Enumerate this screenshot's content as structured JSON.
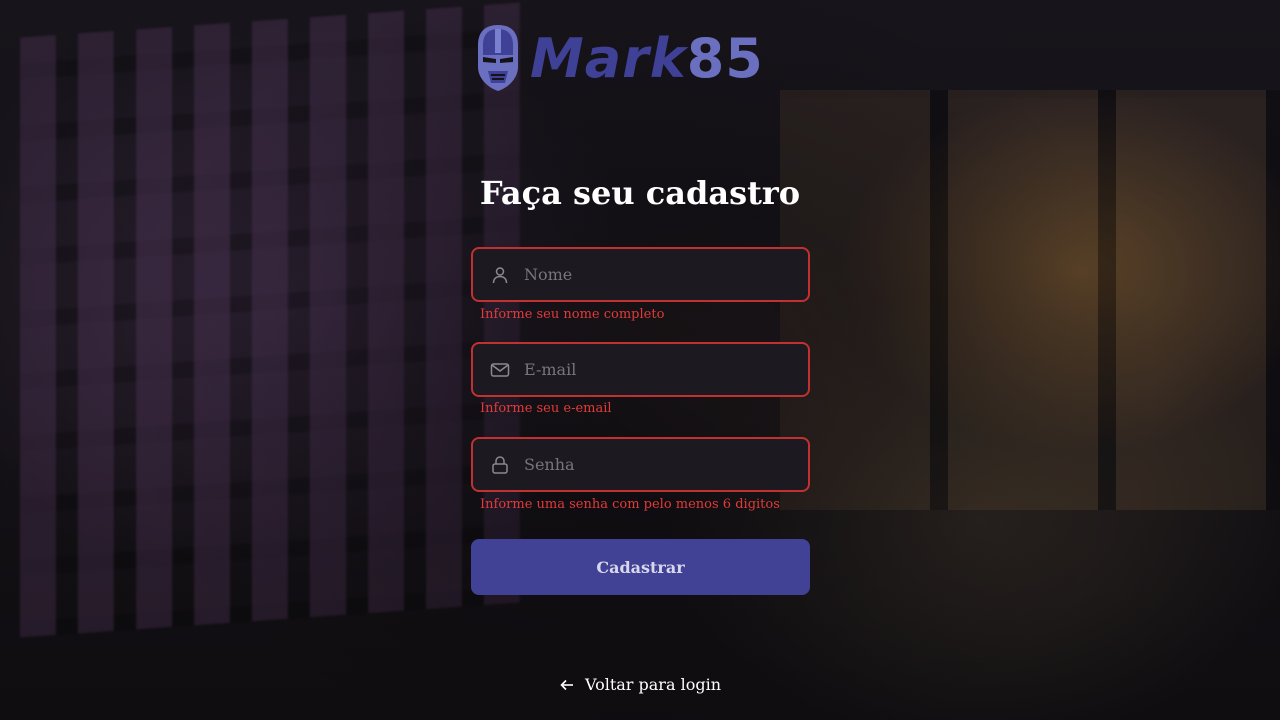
{
  "logo": {
    "part1": "Mark",
    "part2": "85",
    "icon": "iron-mask-icon"
  },
  "title": "Faça seu cadastro",
  "fields": {
    "name": {
      "placeholder": "Nome",
      "value": "",
      "error": "Informe seu nome completo",
      "icon": "user-icon"
    },
    "email": {
      "placeholder": "E-mail",
      "value": "",
      "error": "Informe seu e-email",
      "icon": "mail-icon"
    },
    "password": {
      "placeholder": "Senha",
      "value": "",
      "error": "Informe uma senha com pelo menos 6 digitos",
      "icon": "lock-icon"
    }
  },
  "submit_label": "Cadastrar",
  "back_link": {
    "label": "Voltar para login",
    "icon": "arrow-left-icon"
  },
  "colors": {
    "accent": "#414196",
    "error": "#e23a3a",
    "error_border": "#c2302f",
    "input_bg": "#1c1a20",
    "logo_dark": "#3f4196",
    "logo_light": "#6a6fbf"
  }
}
